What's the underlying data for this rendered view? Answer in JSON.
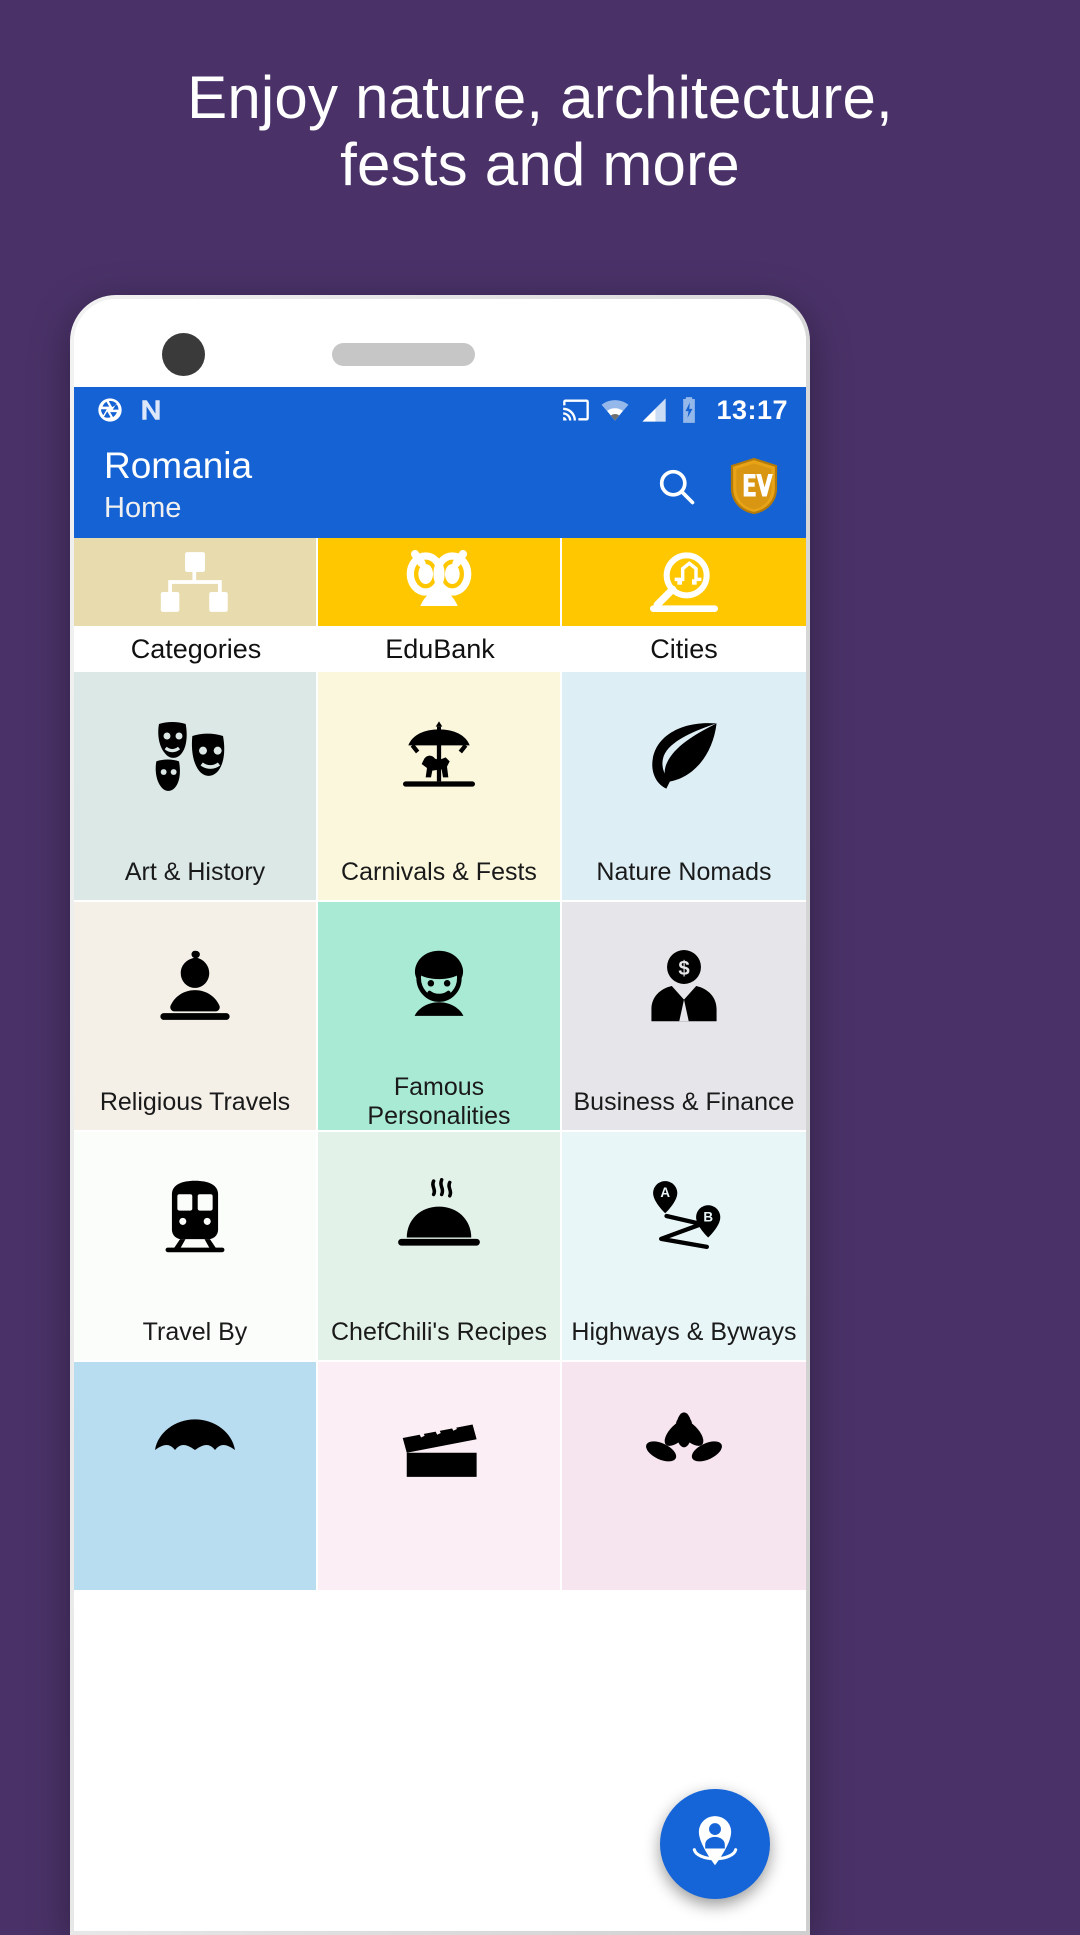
{
  "promo": {
    "headline_line1": "Enjoy nature, architecture,",
    "headline_line2": "fests and more",
    "background_color": "#4a3268"
  },
  "status_bar": {
    "time": "13:17",
    "left_icons": [
      "aperture-icon",
      "nfc-icon"
    ],
    "right_icons": [
      "cast-icon",
      "wifi-icon",
      "signal-icon",
      "battery-charging-icon"
    ],
    "background_color": "#1462d3"
  },
  "app_bar": {
    "title": "Romania",
    "subtitle": "Home",
    "search_label": "Search",
    "logo_label": "EV",
    "background_color": "#1462d3"
  },
  "tabs": [
    {
      "label": "Categories",
      "icon": "sitemap-icon",
      "bg": "#e8dcae",
      "selected": true
    },
    {
      "label": "EduBank",
      "icon": "owl-icon",
      "bg": "#fec700",
      "selected": false
    },
    {
      "label": "Cities",
      "icon": "city-search-icon",
      "bg": "#fec700",
      "selected": false
    }
  ],
  "grid": [
    {
      "label": "Art & History",
      "icon": "theater-masks-icon",
      "bg": "#dbe8e6"
    },
    {
      "label": "Carnivals & Fests",
      "icon": "carousel-icon",
      "bg": "#fbf7dd"
    },
    {
      "label": "Nature Nomads",
      "icon": "leaf-icon",
      "bg": "#ddeef5"
    },
    {
      "label": "Religious Travels",
      "icon": "buddha-icon",
      "bg": "#f4f0e8"
    },
    {
      "label": "Famous Personalities",
      "icon": "person-face-icon",
      "bg": "#a9ead5"
    },
    {
      "label": "Business & Finance",
      "icon": "businessman-icon",
      "bg": "#e6e6ea"
    },
    {
      "label": "Travel By",
      "icon": "train-icon",
      "bg": "#fbfdfb"
    },
    {
      "label": "ChefChili's Recipes",
      "icon": "cloche-icon",
      "bg": "#e2f2e8"
    },
    {
      "label": "Highways & Byways",
      "icon": "route-icon",
      "bg": "#e9f6f8"
    },
    {
      "label": "",
      "icon": "umbrella-icon",
      "bg": "#b8dcf0"
    },
    {
      "label": "",
      "icon": "clapperboard-icon",
      "bg": "#fbeff5"
    },
    {
      "label": "",
      "icon": "flower-icon",
      "bg": "#f6e4ef"
    }
  ],
  "fab": {
    "label": "Nearby",
    "icon": "person-pin-icon",
    "color": "#1565d8"
  }
}
